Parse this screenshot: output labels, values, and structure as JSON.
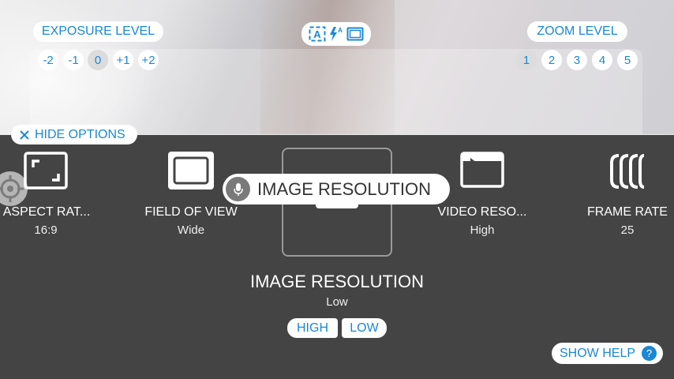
{
  "exposure": {
    "title": "EXPOSURE LEVEL",
    "levels": [
      "-2",
      "-1",
      "0",
      "+1",
      "+2"
    ],
    "selected": "0"
  },
  "mode_indicator": {
    "icons": [
      "auto-mode-icon",
      "auto-flash-icon",
      "aspect-frame-icon"
    ]
  },
  "zoom": {
    "title": "ZOOM LEVEL",
    "levels": [
      "1",
      "2",
      "3",
      "4",
      "5"
    ],
    "selected": "1"
  },
  "hide_options": {
    "label": "HIDE OPTIONS"
  },
  "options": [
    {
      "label": "ASPECT RAT...",
      "value": "16:9",
      "icon": "aspect-ratio-icon"
    },
    {
      "label": "FIELD OF VIEW",
      "value": "Wide",
      "icon": "field-of-view-icon"
    },
    {
      "label": "VIDEO RESO...",
      "value": "High",
      "icon": "video-resolution-icon"
    },
    {
      "label": "FRAME RATE",
      "value": "25",
      "icon": "frame-rate-icon"
    }
  ],
  "voice_hint": {
    "text": "IMAGE RESOLUTION",
    "icon": "microphone-icon"
  },
  "selected_option": {
    "title": "IMAGE RESOLUTION",
    "value": "Low",
    "choices": [
      "HIGH",
      "LOW"
    ]
  },
  "help": {
    "label": "SHOW HELP",
    "badge": "?"
  },
  "colors": {
    "accent": "#1a88d4",
    "panel": "#444444",
    "pill": "#ffffff"
  }
}
